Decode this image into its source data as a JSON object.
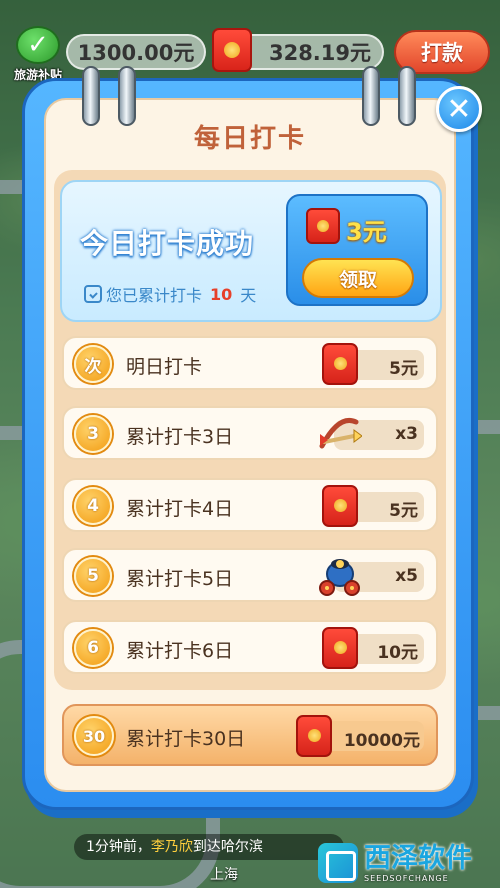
{
  "hud": {
    "subsidy_label": "旅游补贴",
    "cash_amount": "1300.00元",
    "red_envelope_amount": "328.19元",
    "cashout_label": "打款"
  },
  "modal": {
    "title": "每日打卡",
    "close_symbol": "✕",
    "today": {
      "title": "今日打卡成功",
      "days_prefix": "您已累计打卡",
      "days_count": "10",
      "days_suffix": "天",
      "reward_amount": "3元",
      "claim_label": "领取"
    },
    "rows": [
      {
        "badge": "次",
        "label": "明日打卡",
        "reward_icon": "red-envelope-icon",
        "reward": "5元"
      },
      {
        "badge": "3",
        "label": "累计打卡3日",
        "reward_icon": "crossbow-icon",
        "reward": "x3"
      },
      {
        "badge": "4",
        "label": "累计打卡4日",
        "reward_icon": "red-envelope-icon",
        "reward": "5元"
      },
      {
        "badge": "5",
        "label": "累计打卡5日",
        "reward_icon": "cannon-icon",
        "reward": "x5"
      },
      {
        "badge": "6",
        "label": "累计打卡6日",
        "reward_icon": "red-envelope-icon",
        "reward": "10元"
      },
      {
        "badge": "30",
        "label": "累计打卡30日",
        "reward_icon": "red-envelope-icon",
        "reward": "10000元"
      }
    ]
  },
  "ticker": {
    "time": "1分钟前，",
    "who": "李乃欣",
    "text": "到达哈尔滨"
  },
  "city_label": "上海",
  "watermark": {
    "title": "西泽软件",
    "subtitle": "SEEDSOFCHANGE"
  },
  "colors": {
    "modal_blue": "#2b8df0",
    "paper": "#fdf4e5",
    "title_orange": "#c0623a",
    "badge_orange": "#f29b12",
    "accent_red": "#e6402a"
  }
}
